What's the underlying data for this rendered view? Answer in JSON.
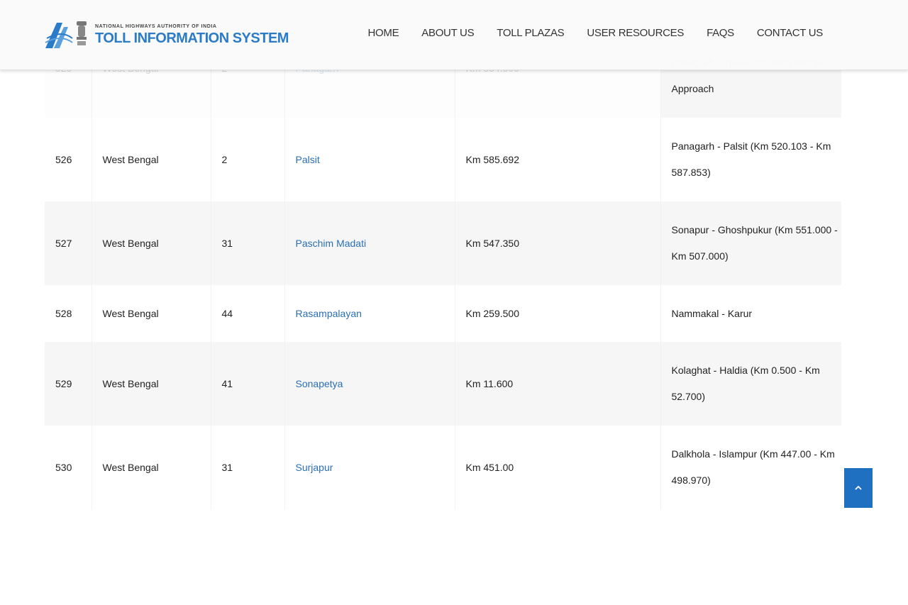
{
  "header": {
    "logo_subtitle": "NATIONAL HIGHWAYS AUTHORITY OF INDIA",
    "logo_title": "TOLL INFORMATION SYSTEM",
    "nav": [
      {
        "label": "HOME"
      },
      {
        "label": "ABOUT US"
      },
      {
        "label": "TOLL PLAZAS"
      },
      {
        "label": "USER RESOURCES"
      },
      {
        "label": "FAQS"
      },
      {
        "label": "CONTACT US"
      }
    ]
  },
  "table": {
    "partial_row": {
      "sno": "525",
      "state": "West Bengal",
      "nh": "2",
      "plaza": "Panagarh",
      "location": "Km 554.500",
      "section_line1": "Panagarh Bypass including Bridge &",
      "section_line2": "Approach"
    },
    "rows": [
      {
        "sno": "526",
        "state": "West Bengal",
        "nh": "2",
        "plaza": "Palsit",
        "location": "Km 585.692",
        "section_line1": "Panagarh - Palsit (Km 520.103 - Km",
        "section_line2": "587.853)"
      },
      {
        "sno": "527",
        "state": "West Bengal",
        "nh": "31",
        "plaza": "Paschim Madati",
        "location": "Km 547.350",
        "section_line1": "Sonapur - Ghoshpukur (Km 551.000 -",
        "section_line2": "Km 507.000)"
      },
      {
        "sno": "528",
        "state": "West Bengal",
        "nh": "44",
        "plaza": "Rasampalayan",
        "location": "Km 259.500",
        "section_line1": "Nammakal - Karur",
        "section_line2": ""
      },
      {
        "sno": "529",
        "state": "West Bengal",
        "nh": "41",
        "plaza": "Sonapetya",
        "location": "Km 11.600",
        "section_line1": "Kolaghat - Haldia (Km 0.500 - Km",
        "section_line2": "52.700)"
      },
      {
        "sno": "530",
        "state": "West Bengal",
        "nh": "31",
        "plaza": "Surjapur",
        "location": "Km 451.00",
        "section_line1": "Dalkhola - Islampur (Km 447.00 - Km",
        "section_line2": "498.970)"
      }
    ]
  },
  "back_to_top": {
    "icon": "chevron-up-icon",
    "color": "#1f70c1"
  },
  "colors": {
    "link": "#2a6fb5",
    "row_alt": "#f6f6f6",
    "brand": "#2b7bc8"
  }
}
